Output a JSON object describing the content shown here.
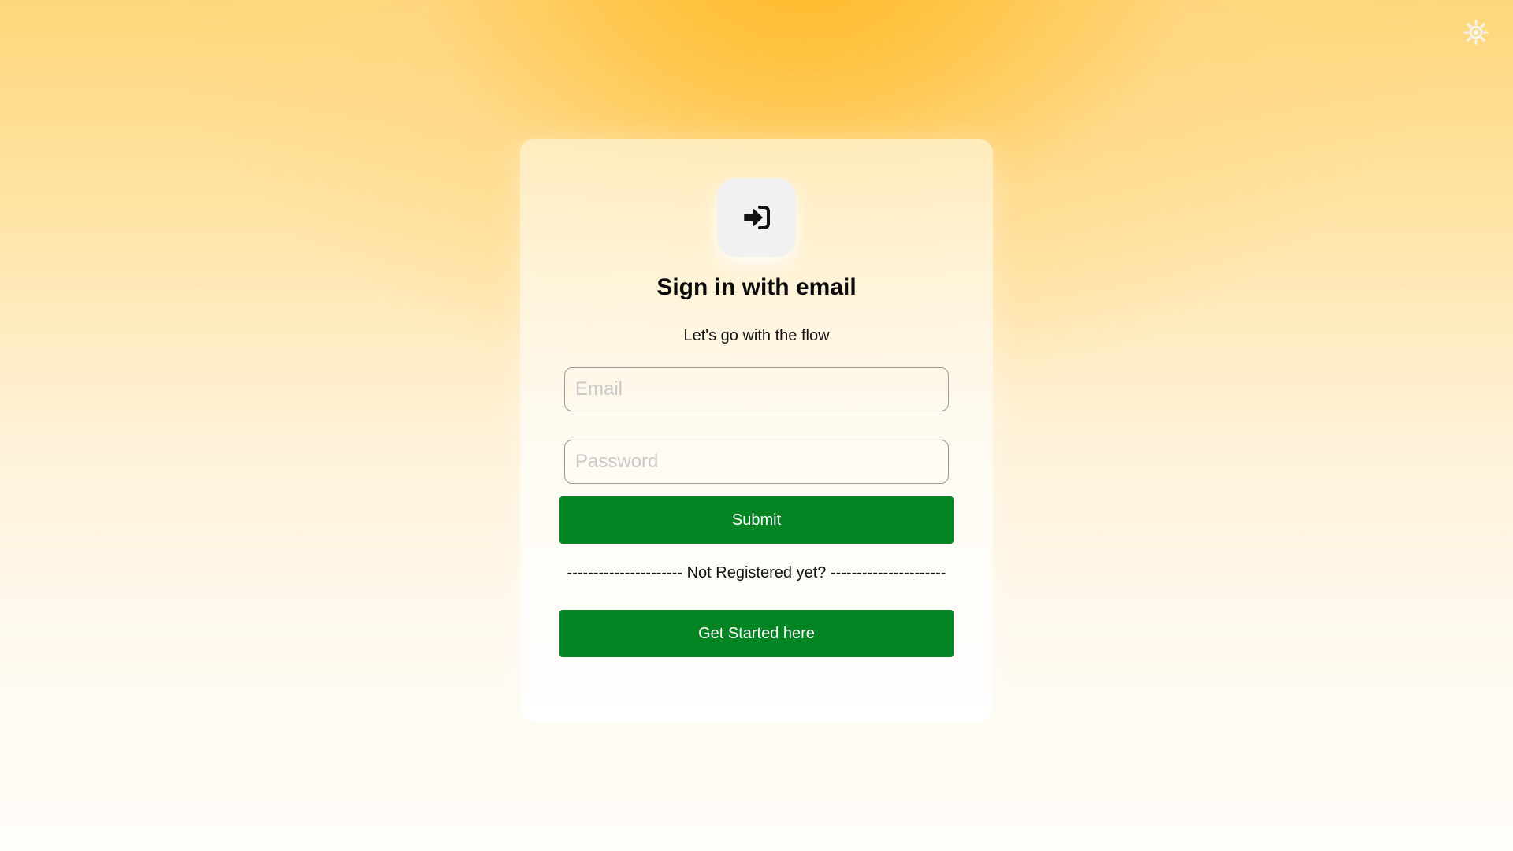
{
  "theme_toggle": {
    "icon": "sun-icon",
    "color": "#f4f4f4"
  },
  "card": {
    "logo_icon": "sign-in-arrow-icon",
    "title": "Sign in with email",
    "subtitle": "Let's go with the flow",
    "email": {
      "placeholder": "Email",
      "value": ""
    },
    "password": {
      "placeholder": "Password",
      "value": ""
    },
    "submit_label": "Submit",
    "divider_text": "---------------------- Not Registered yet? ----------------------",
    "get_started_label": "Get Started here"
  },
  "colors": {
    "primary_button": "#028522",
    "background_accent": "#ffba28"
  }
}
